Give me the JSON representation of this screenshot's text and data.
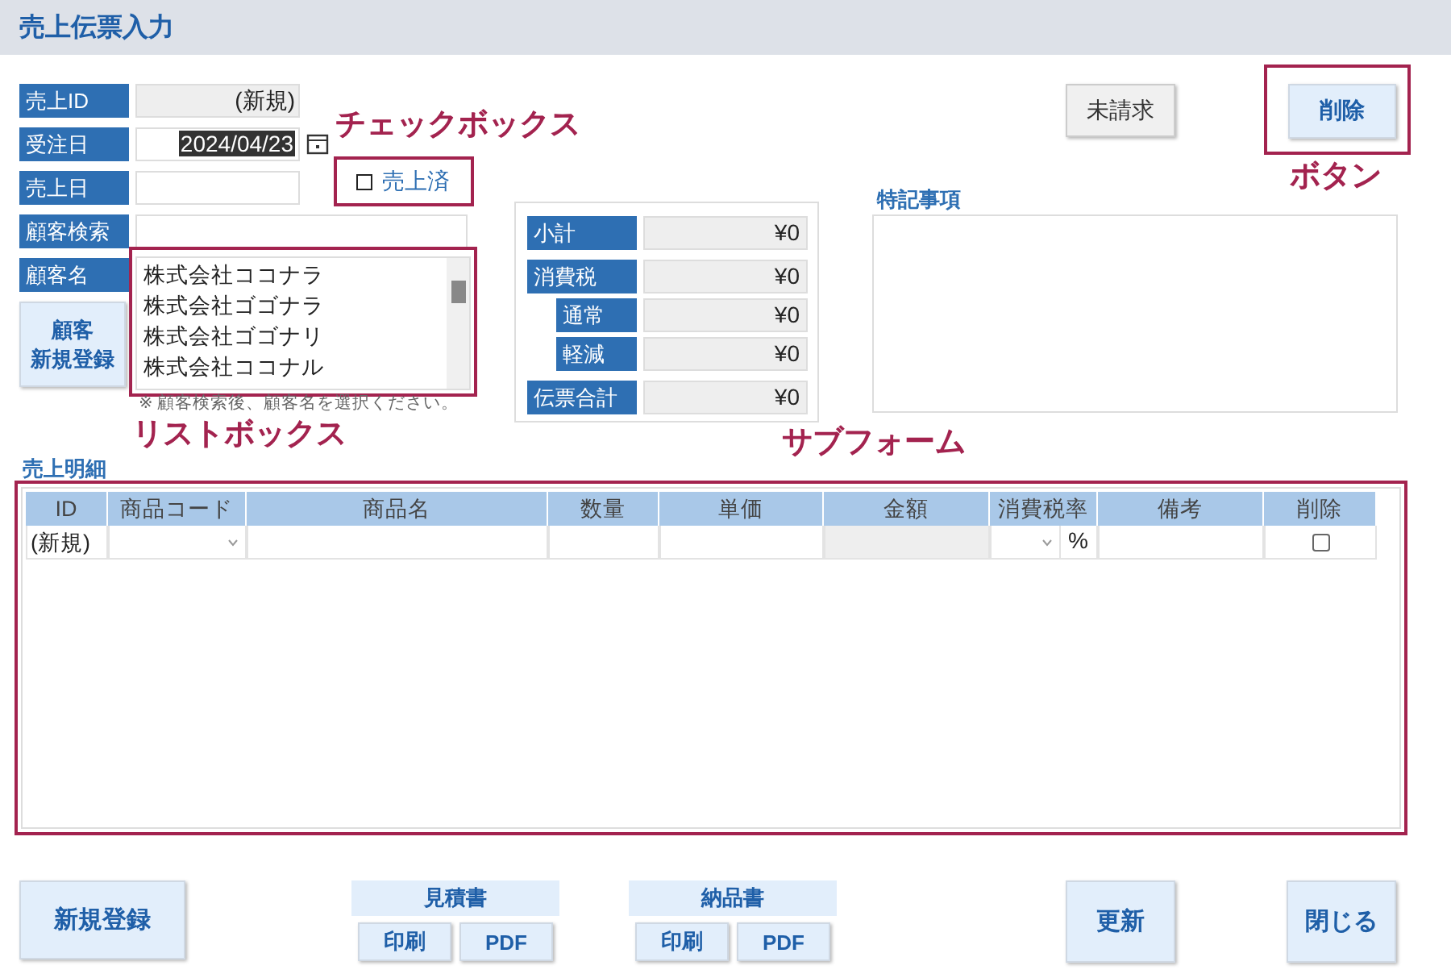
{
  "window": {
    "title": "売上伝票入力"
  },
  "fields": [
    {
      "label": "売上ID",
      "kind": "readonly",
      "value": "(新規)"
    },
    {
      "label": "受注日",
      "kind": "date",
      "value": "2024/04/23",
      "value_selected": true
    },
    {
      "label": "売上日",
      "kind": "text"
    },
    {
      "label": "顧客検索",
      "kind": "search"
    },
    {
      "label": "顧客名",
      "kind": "list"
    }
  ],
  "sold_checkbox": {
    "label": "売上済",
    "checked": false,
    "annotation": "チェックボックス"
  },
  "customer_list": {
    "items": [
      "株式会社ココナラ",
      "株式会社ゴゴナラ",
      "株式会社ゴゴナリ",
      "株式会社ココナル"
    ],
    "note": "※ 顧客検索後、顧客名を選択ください。",
    "annotation": "リストボックス"
  },
  "new_customer_button": [
    "顧客",
    "新規登録"
  ],
  "totals": [
    {
      "label": "小計",
      "value": "¥0",
      "indent": false
    },
    {
      "label": "消費税",
      "value": "¥0",
      "indent": false
    },
    {
      "label": "通常",
      "value": "¥0",
      "indent": true
    },
    {
      "label": "軽減",
      "value": "¥0",
      "indent": true
    },
    {
      "label": "伝票合計",
      "value": "¥0",
      "indent": false
    }
  ],
  "notes": {
    "label": "特記事項"
  },
  "unbilled_button": "未請求",
  "delete_button": {
    "label": "削除",
    "annotation": "ボタン"
  },
  "details": {
    "label": "売上明細",
    "annotation": "サブフォーム",
    "columns": [
      "ID",
      "商品コード",
      "商品名",
      "数量",
      "単価",
      "金額",
      "消費税率",
      "備考",
      "削除"
    ],
    "rows": [
      {
        "cells": [
          {
            "kind": "text",
            "value": "(新規)"
          },
          {
            "kind": "combo"
          },
          {
            "kind": "text"
          },
          {
            "kind": "text"
          },
          {
            "kind": "text"
          },
          {
            "kind": "locked"
          },
          {
            "kind": "combo",
            "suffix": "%"
          },
          {
            "kind": "text"
          },
          {
            "kind": "check",
            "checked": false
          }
        ]
      }
    ]
  },
  "footer": {
    "new_button": "新規登録",
    "groups": [
      {
        "title": "見積書",
        "buttons": [
          "印刷",
          "PDF"
        ]
      },
      {
        "title": "納品書",
        "buttons": [
          "印刷",
          "PDF"
        ]
      }
    ],
    "update_button": "更新",
    "close_button": "閉じる"
  }
}
